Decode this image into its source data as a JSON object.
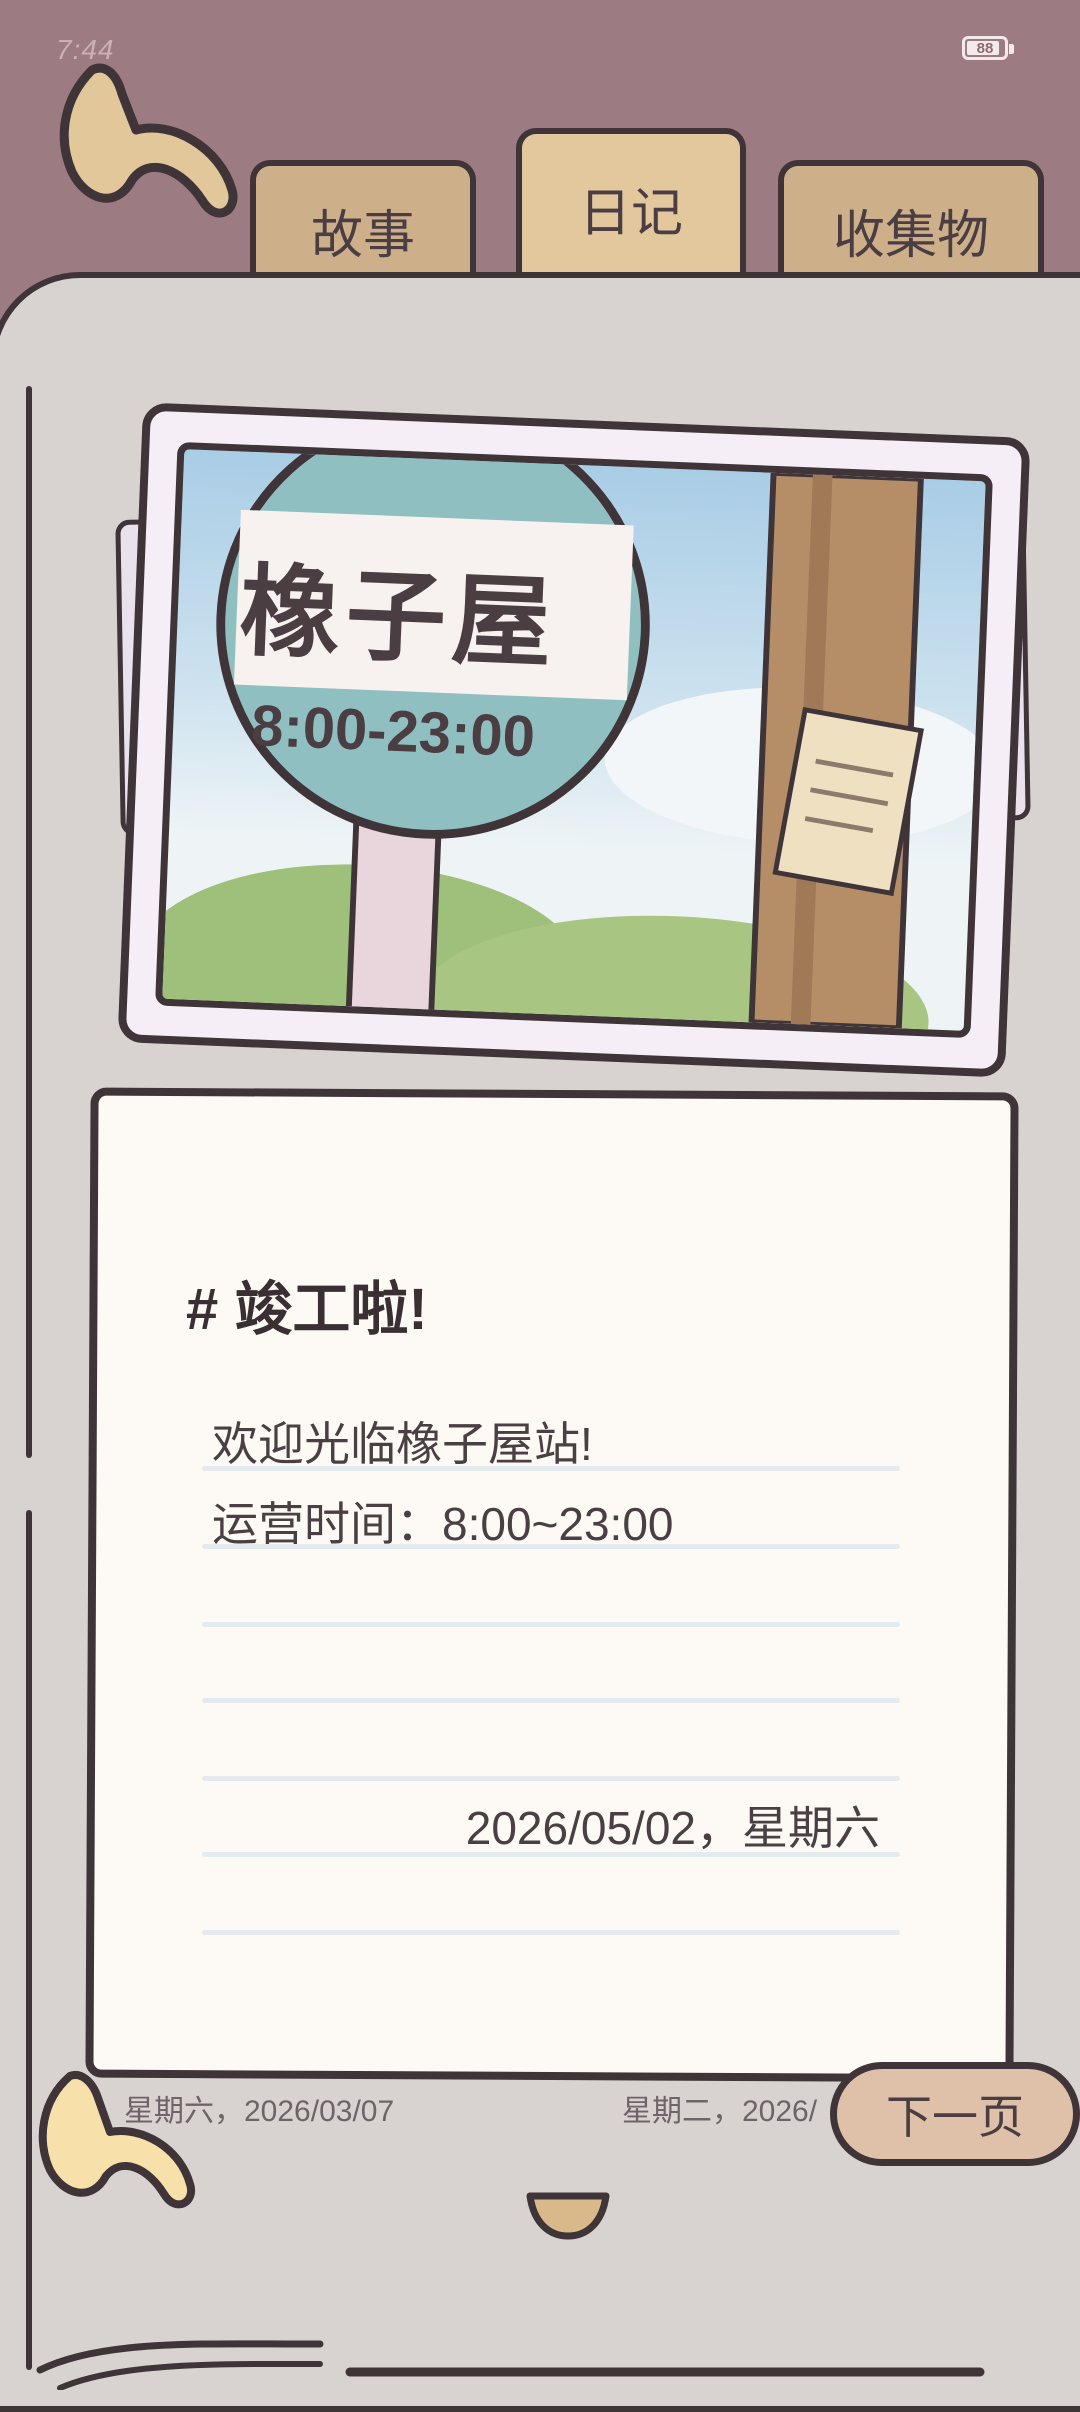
{
  "status_bar": {
    "time": "7:44",
    "battery_level": "88"
  },
  "tabs": [
    {
      "label": "故事",
      "active": false
    },
    {
      "label": "日记",
      "active": true
    },
    {
      "label": "收集物",
      "active": false
    }
  ],
  "photo": {
    "sign_title": "橡子屋",
    "sign_hours": "8:00-23:00"
  },
  "entry": {
    "title": "# 竣工啦!",
    "lines": [
      "欢迎光临橡子屋站!",
      "运营时间：8:00~23:00"
    ],
    "date": "2026/05/02，星期六"
  },
  "behind_previews": {
    "left": "星期六，2026/03/07",
    "right": "星期二，2026/"
  },
  "next_button": {
    "label": "下一页"
  },
  "colors": {
    "background_top": "#9c7c82",
    "book": "#d8d3d1",
    "outline": "#3f3438",
    "tab": "#cdb08a",
    "tab_active": "#e2c89c",
    "card": "#fdfaf5",
    "button": "#dfc0a9"
  }
}
